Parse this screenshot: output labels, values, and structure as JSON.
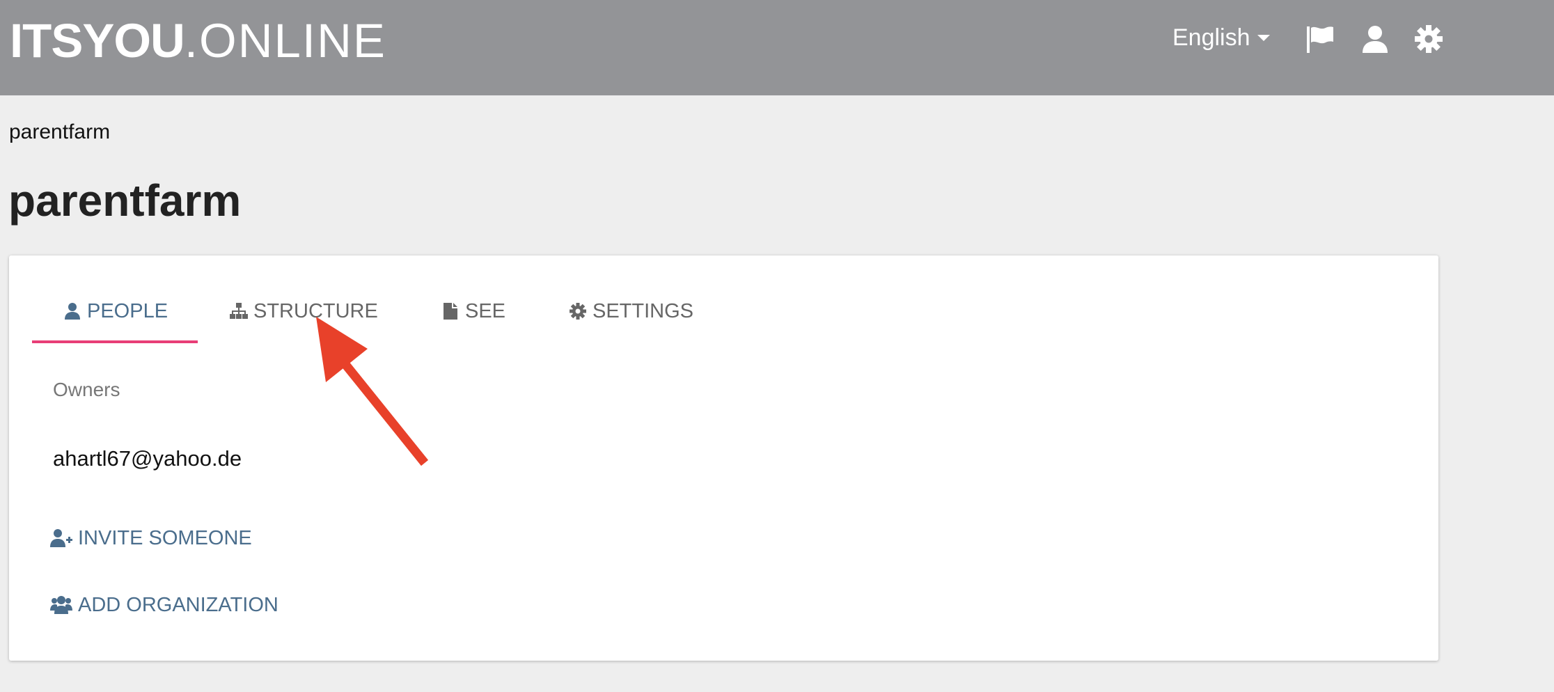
{
  "header": {
    "logo_bold": "ITSYOU",
    "logo_thin": ".ONLINE",
    "language": "English",
    "icons": [
      "flag-icon",
      "user-icon",
      "gear-icon"
    ]
  },
  "breadcrumb": "parentfarm",
  "page_title": "parentfarm",
  "tabs": [
    {
      "label": "PEOPLE",
      "icon": "user-icon",
      "active": true
    },
    {
      "label": "STRUCTURE",
      "icon": "sitemap-icon",
      "active": false
    },
    {
      "label": "SEE",
      "icon": "file-icon",
      "active": false
    },
    {
      "label": "SETTINGS",
      "icon": "gear-icon",
      "active": false
    }
  ],
  "people": {
    "owners_label": "Owners",
    "owners": [
      "ahartl67@yahoo.de"
    ],
    "invite_label": "INVITE SOMEONE",
    "add_org_label": "ADD ORGANIZATION"
  },
  "colors": {
    "header_bg": "#939497",
    "page_bg": "#eeeeee",
    "accent": "#4a6d8c",
    "tab_underline": "#e83e77",
    "annotation_arrow": "#e8412a"
  }
}
